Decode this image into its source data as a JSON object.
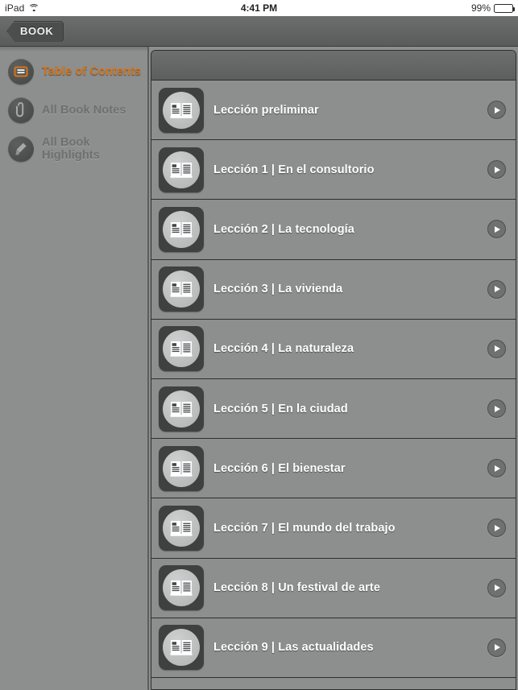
{
  "status_bar": {
    "device": "iPad",
    "wifi_icon": "wifi-icon",
    "time": "4:41 PM",
    "battery_percent": "99%",
    "battery_icon": "battery-icon"
  },
  "nav_bar": {
    "back_label": "BOOK",
    "back_icon": "chevron-left-icon"
  },
  "sidebar": {
    "items": [
      {
        "label": "Table of Contents",
        "icon": "book-icon",
        "active": true
      },
      {
        "label": "All Book Notes",
        "icon": "paperclip-icon",
        "active": false
      },
      {
        "label": "All Book Highlights",
        "icon": "highlighter-icon",
        "active": false
      }
    ]
  },
  "toc": {
    "rows": [
      {
        "label": "Lección preliminar",
        "icon": "open-book-icon",
        "action_icon": "play-icon"
      },
      {
        "label": "Lección 1 | En el consultorio",
        "icon": "open-book-icon",
        "action_icon": "play-icon"
      },
      {
        "label": "Lección 2 | La tecnología",
        "icon": "open-book-icon",
        "action_icon": "play-icon"
      },
      {
        "label": "Lección 3 | La vivienda",
        "icon": "open-book-icon",
        "action_icon": "play-icon"
      },
      {
        "label": "Lección 4 | La naturaleza",
        "icon": "open-book-icon",
        "action_icon": "play-icon"
      },
      {
        "label": "Lección 5 | En la ciudad",
        "icon": "open-book-icon",
        "action_icon": "play-icon"
      },
      {
        "label": "Lección 6 | El bienestar",
        "icon": "open-book-icon",
        "action_icon": "play-icon"
      },
      {
        "label": "Lección 7 | El mundo del trabajo",
        "icon": "open-book-icon",
        "action_icon": "play-icon"
      },
      {
        "label": "Lección 8 | Un festival de arte",
        "icon": "open-book-icon",
        "action_icon": "play-icon"
      },
      {
        "label": "Lección 9 | Las actualidades",
        "icon": "open-book-icon",
        "action_icon": "play-icon"
      }
    ]
  },
  "colors": {
    "accent_orange": "#d2761e",
    "panel_bg": "#8d8e8e",
    "nav_bg": "#636464",
    "separator": "#2d2e2e"
  }
}
